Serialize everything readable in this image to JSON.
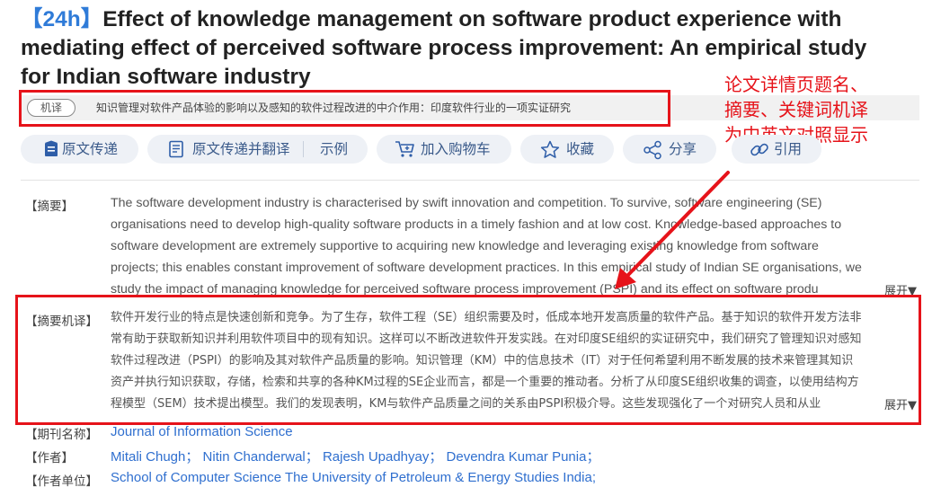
{
  "paper": {
    "tag": "【24h】",
    "title_lines": [
      "Effect of knowledge management on software product experience with",
      "mediating effect of perceived software process improvement: An empirical study",
      "for Indian software industry"
    ]
  },
  "machine_translation": {
    "badge": "机译",
    "title_text": "知识管理对软件产品体验的影响以及感知的软件过程改进的中介作用：印度软件行业的一项实证研究"
  },
  "annotation": {
    "lines": [
      "论文详情页题名、",
      "摘要、关键词机译",
      "为中英文对照显示"
    ],
    "color": "#e6131a"
  },
  "actions": {
    "original_delivery": "原文传递",
    "delivery_translate": "原文传递并翻译",
    "example": "示例",
    "add_cart": "加入购物车",
    "favorite": "收藏",
    "share": "分享",
    "cite": "引用"
  },
  "abstract": {
    "label": "【摘要】",
    "lines": [
      "The software development industry is characterised by swift innovation and competition. To survive, software engineering (SE)",
      "organisations need to develop high-quality software products in a timely fashion and at low cost. Knowledge-based approaches to",
      "software development are extremely supportive to acquiring new knowledge and leveraging existing knowledge from software",
      "projects; this enables constant improvement of software development practices. In this empirical study of Indian SE organisations, we",
      "study the impact of managing knowledge for perceived software process improvement (PSPI) and its effect on software produ"
    ],
    "expand": "展开▼"
  },
  "abstract_translation": {
    "label": "【摘要机译】",
    "lines": [
      "软件开发行业的特点是快速创新和竞争。为了生存，软件工程（SE）组织需要及时，低成本地开发高质量的软件产品。基于知识的软件开发方法非",
      "常有助于获取新知识并利用软件项目中的现有知识。这样可以不断改进软件开发实践。在对印度SE组织的实证研究中，我们研究了管理知识对感知",
      "软件过程改进（PSPI）的影响及其对软件产品质量的影响。知识管理（KM）中的信息技术（IT）对于任何希望利用不断发展的技术来管理其知识",
      "资产并执行知识获取，存储，检索和共享的各种KM过程的SE企业而言，都是一个重要的推动者。分析了从印度SE组织收集的调查，以使用结构方",
      "程模型（SEM）技术提出模型。我们的发现表明，KM与软件产品质量之间的关系由PSPI积极介导。这些发现强化了一个对研究人员和从业"
    ],
    "expand": "展开▼"
  },
  "journal": {
    "label": "【期刊名称】",
    "value": "Journal of Information Science"
  },
  "authors": {
    "label": "【作者】",
    "names": [
      "Mitali Chugh；",
      "Nitin Chanderwal；",
      "Rajesh Upadhyay；",
      "Devendra Kumar Punia；"
    ]
  },
  "affiliation": {
    "label": "【作者单位】",
    "value": "School of Computer Science The University of Petroleum & Energy Studies India;"
  }
}
